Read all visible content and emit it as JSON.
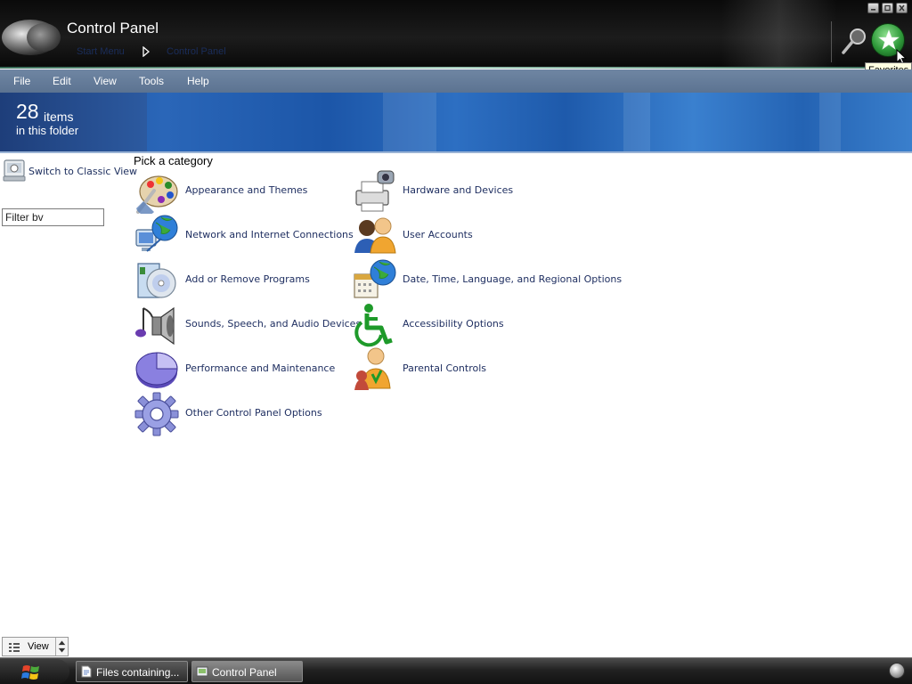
{
  "window": {
    "title": "Control Panel",
    "breadcrumbs": [
      "Start Menu",
      "Control Panel"
    ],
    "favorites_tooltip": "Favorites"
  },
  "menu": [
    "File",
    "Edit",
    "View",
    "Tools",
    "Help"
  ],
  "banner": {
    "count": "28",
    "count_unit": "items",
    "subtitle": "in this folder"
  },
  "sidebar": {
    "classic_view_label": "Switch to Classic View",
    "filter_value": "Filter bv"
  },
  "main": {
    "heading": "Pick a category",
    "categories": [
      {
        "label": "Appearance and Themes",
        "icon": "palette-icon"
      },
      {
        "label": "Hardware and Devices",
        "icon": "printer-camera-icon"
      },
      {
        "label": "Network and Internet Connections",
        "icon": "network-globe-icon"
      },
      {
        "label": "User Accounts",
        "icon": "users-icon"
      },
      {
        "label": "Add or Remove Programs",
        "icon": "cd-box-icon"
      },
      {
        "label": "Date, Time, Language, and Regional Options",
        "icon": "calendar-globe-icon"
      },
      {
        "label": "Sounds, Speech, and Audio Devices",
        "icon": "speaker-note-icon"
      },
      {
        "label": "Accessibility Options",
        "icon": "wheelchair-icon"
      },
      {
        "label": "Performance and Maintenance",
        "icon": "pie-chart-icon"
      },
      {
        "label": "Parental Controls",
        "icon": "parent-child-icon"
      },
      {
        "label": "Other Control Panel Options",
        "icon": "gear-icon"
      }
    ]
  },
  "view_control": {
    "label": "View"
  },
  "taskbar": {
    "tasks": [
      {
        "label": "Files containing...",
        "icon": "document-icon"
      },
      {
        "label": "Control Panel",
        "icon": "control-panel-icon"
      }
    ]
  },
  "colors": {
    "menubar": "#6f86a3",
    "banner": "#2a66b8",
    "link_text": "#1f2f61"
  }
}
